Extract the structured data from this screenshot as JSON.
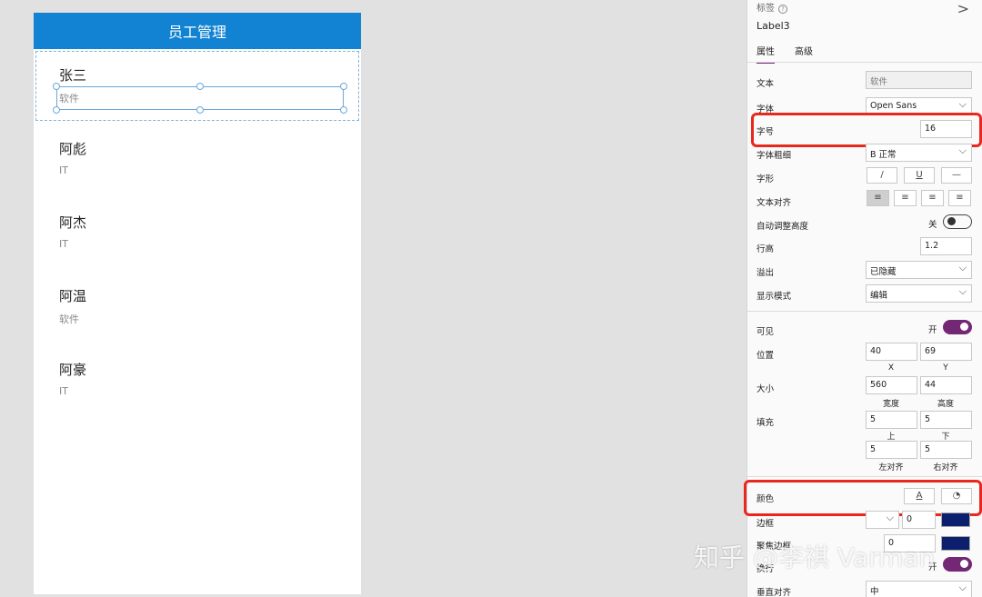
{
  "app": {
    "header_title": "员工管理",
    "employees": [
      {
        "name": "张三",
        "dept": "软件"
      },
      {
        "name": "阿彪",
        "dept": "IT"
      },
      {
        "name": "阿杰",
        "dept": "IT"
      },
      {
        "name": "阿温",
        "dept": "软件"
      },
      {
        "name": "阿豪",
        "dept": "IT"
      }
    ]
  },
  "pane": {
    "top_label": "标签",
    "help_icon": "?",
    "expand_icon": ">",
    "control_name": "Label3",
    "tabs": [
      "属性",
      "高级"
    ],
    "text_label": "文本",
    "text_value": "软件",
    "font_label": "字体",
    "font_value": "Open Sans",
    "size_label": "字号",
    "size_value": "16",
    "weight_label": "字体粗细",
    "weight_value": "B  正常",
    "style_label": "字形",
    "style_buttons": [
      "/",
      "U",
      "—"
    ],
    "align_label": "文本对齐",
    "autoheight_label": "自动调整高度",
    "autoheight_state": "关",
    "lineheight_label": "行高",
    "lineheight_value": "1.2",
    "overflow_label": "溢出",
    "overflow_value": "已隐藏",
    "mode_label": "显示模式",
    "mode_value": "编辑",
    "visible_label": "可见",
    "visible_state": "开",
    "position_label": "位置",
    "pos_x": "40",
    "pos_y": "69",
    "x_label": "X",
    "y_label": "Y",
    "size2_label": "大小",
    "width_value": "560",
    "height_value": "44",
    "width_label": "宽度",
    "height_label": "高度",
    "padding_label": "填充",
    "pad_top": "5",
    "pad_bottom": "5",
    "pad_top_label": "上",
    "pad_bottom_label": "下",
    "pad_left": "5",
    "pad_right": "5",
    "pad_left_label": "左对齐",
    "pad_right_label": "右对齐",
    "color_label": "颜色",
    "color_font_btn": "A",
    "border_label": "边框",
    "border_value": "0",
    "focus_label": "聚焦边框",
    "focus_value": "0",
    "wrap_label": "换行",
    "wrap_state": "开",
    "valign_label": "垂直对齐",
    "valign_value": "中",
    "accent_color": "#742774",
    "border_swatch": "#0b1f6e",
    "highlight_color": "#e8281d"
  },
  "watermark": "知乎 @李祺 Varman"
}
